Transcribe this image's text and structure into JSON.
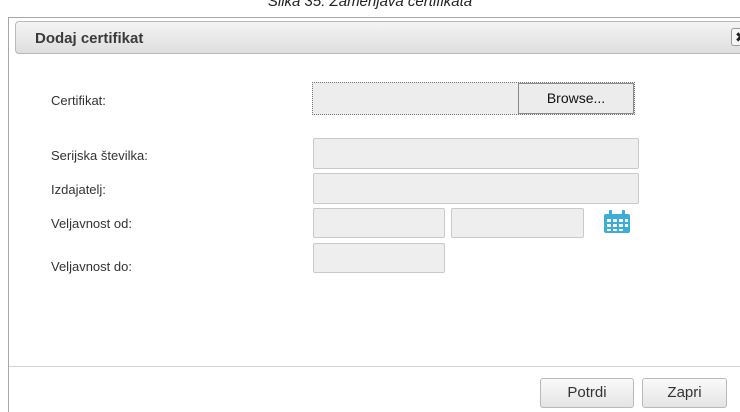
{
  "caption": "Slika 35: Zamenjava certifikata",
  "dialog": {
    "title": "Dodaj certifikat",
    "close_glyph": "✖"
  },
  "form": {
    "certificate_label": "Certifikat:",
    "browse_label": "Browse...",
    "serial_label": "Serijska številka:",
    "issuer_label": "Izdajatelj:",
    "valid_from_label": "Veljavnost od:",
    "valid_to_label": "Veljavnost do:"
  },
  "footer": {
    "confirm_label": "Potrdi",
    "close_label": "Zapri"
  },
  "colors": {
    "calendar_icon": "#3aaed8"
  }
}
